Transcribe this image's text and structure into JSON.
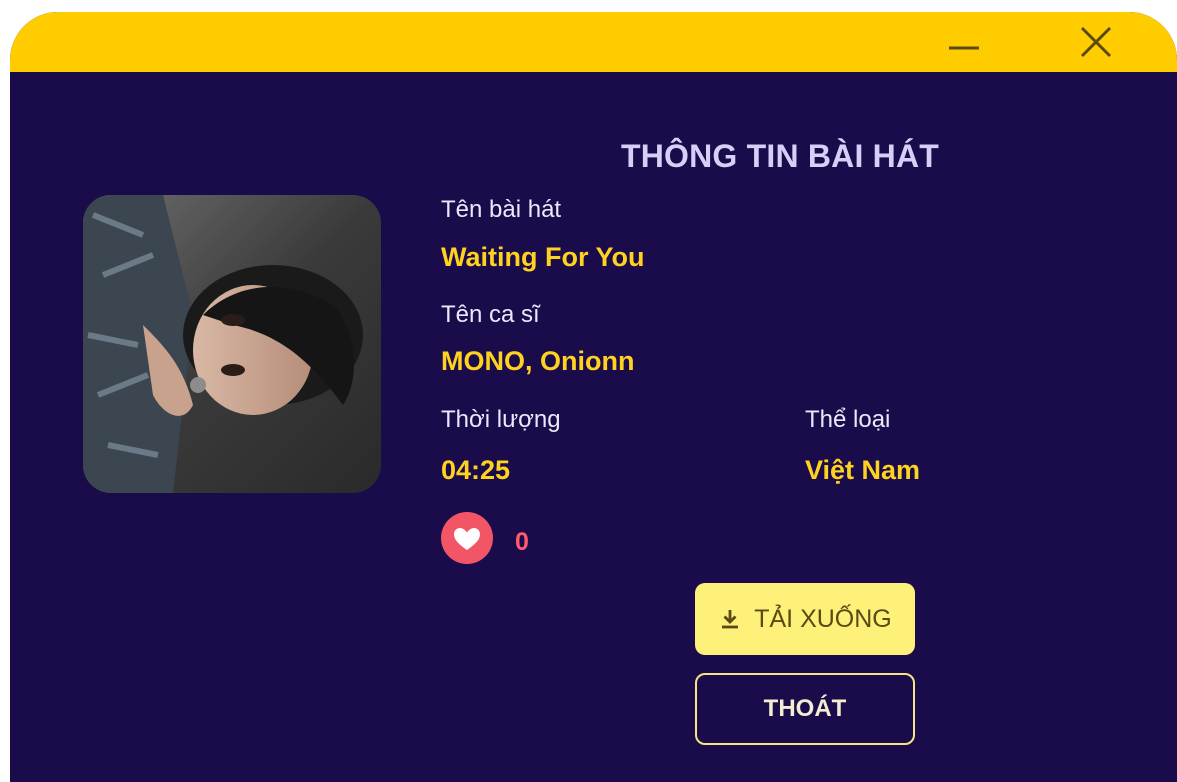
{
  "window": {
    "titlebar_color": "#ffcc00",
    "background_color": "#1a0c4b",
    "controls": {
      "minimize_icon": "minimize-icon",
      "close_icon": "close-icon"
    }
  },
  "song_info": {
    "heading": "THÔNG TIN BÀI HÁT",
    "song_label": "Tên bài hát",
    "song_value": "Waiting For You",
    "artist_label": "Tên ca sĩ",
    "artist_value": "MONO, Onionn",
    "duration_label": "Thời lượng",
    "duration_value": "04:25",
    "genre_label": "Thể loại",
    "genre_value": "Việt Nam",
    "likes": "0"
  },
  "actions": {
    "download_label": "TẢI XUỐNG",
    "download_icon": "download-icon",
    "exit_label": "THOÁT"
  },
  "colors": {
    "accent": "#ffd21f",
    "heart": "#f25566",
    "download_button": "#fdf17a"
  }
}
